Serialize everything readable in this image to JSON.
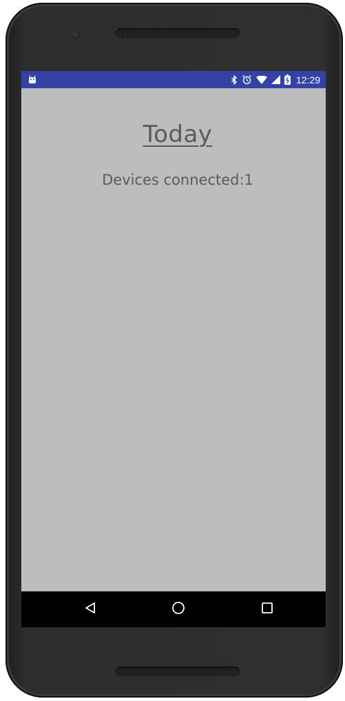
{
  "status_bar": {
    "time": "12:29",
    "background_color": "#3442a6",
    "icons": [
      "android-icon",
      "bluetooth-icon",
      "alarm-icon",
      "wifi-icon",
      "signal-icon",
      "battery-icon"
    ]
  },
  "main": {
    "title": "Today",
    "devices_text": "Devices connected:1",
    "background_color": "#bdbdbd",
    "text_color": "#5a5a5a"
  },
  "nav_bar": {
    "buttons": [
      "back-icon",
      "home-icon",
      "recents-icon"
    ]
  }
}
